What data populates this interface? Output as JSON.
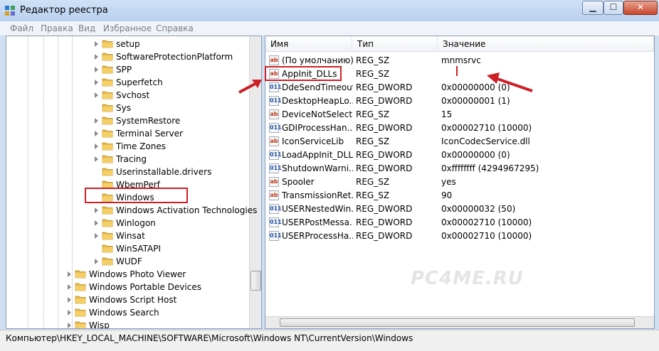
{
  "window": {
    "title": "Редактор реестра"
  },
  "menu": [
    "Файл",
    "Правка",
    "Вид",
    "Избранное",
    "Справка"
  ],
  "tree": {
    "items": [
      {
        "label": "setup",
        "expandable": true
      },
      {
        "label": "SoftwareProtectionPlatform",
        "expandable": true
      },
      {
        "label": "SPP",
        "expandable": true
      },
      {
        "label": "Superfetch",
        "expandable": true
      },
      {
        "label": "Svchost",
        "expandable": true
      },
      {
        "label": "Sys",
        "expandable": false
      },
      {
        "label": "SystemRestore",
        "expandable": true
      },
      {
        "label": "Terminal Server",
        "expandable": true
      },
      {
        "label": "Time Zones",
        "expandable": true
      },
      {
        "label": "Tracing",
        "expandable": true
      },
      {
        "label": "Userinstallable.drivers",
        "expandable": false
      },
      {
        "label": "WbemPerf",
        "expandable": false
      },
      {
        "label": "Windows",
        "expandable": false,
        "highlighted": true
      },
      {
        "label": "Windows Activation Technologies",
        "expandable": true
      },
      {
        "label": "Winlogon",
        "expandable": true
      },
      {
        "label": "Winsat",
        "expandable": true
      },
      {
        "label": "WinSATAPI",
        "expandable": false
      },
      {
        "label": "WUDF",
        "expandable": true
      },
      {
        "label": "Windows Photo Viewer",
        "expandable": true,
        "level": 1
      },
      {
        "label": "Windows Portable Devices",
        "expandable": true,
        "level": 1
      },
      {
        "label": "Windows Script Host",
        "expandable": true,
        "level": 1
      },
      {
        "label": "Windows Search",
        "expandable": true,
        "level": 1
      },
      {
        "label": "Wisp",
        "expandable": true,
        "level": 1
      }
    ]
  },
  "list": {
    "headers": {
      "name": "Имя",
      "type": "Тип",
      "value": "Значение"
    },
    "rows": [
      {
        "name": "(По умолчанию)",
        "type": "REG_SZ",
        "value": "mnmsrvc",
        "icon": "string-value-icon"
      },
      {
        "name": "AppInit_DLLs",
        "type": "REG_SZ",
        "value": "",
        "icon": "string-value-icon",
        "highlighted": true
      },
      {
        "name": "DdeSendTimeout",
        "type": "REG_DWORD",
        "value": "0x00000000 (0)",
        "icon": "dword-value-icon"
      },
      {
        "name": "DesktopHeapLo...",
        "type": "REG_DWORD",
        "value": "0x00000001 (1)",
        "icon": "dword-value-icon"
      },
      {
        "name": "DeviceNotSelect...",
        "type": "REG_SZ",
        "value": "15",
        "icon": "string-value-icon"
      },
      {
        "name": "GDIProcessHan...",
        "type": "REG_DWORD",
        "value": "0x00002710 (10000)",
        "icon": "dword-value-icon"
      },
      {
        "name": "IconServiceLib",
        "type": "REG_SZ",
        "value": "IconCodecService.dll",
        "icon": "string-value-icon"
      },
      {
        "name": "LoadAppInit_DLLs",
        "type": "REG_DWORD",
        "value": "0x00000000 (0)",
        "icon": "dword-value-icon"
      },
      {
        "name": "ShutdownWarni...",
        "type": "REG_DWORD",
        "value": "0xffffffff (4294967295)",
        "icon": "dword-value-icon"
      },
      {
        "name": "Spooler",
        "type": "REG_SZ",
        "value": "yes",
        "icon": "string-value-icon"
      },
      {
        "name": "TransmissionRet...",
        "type": "REG_SZ",
        "value": "90",
        "icon": "string-value-icon"
      },
      {
        "name": "USERNestedWin...",
        "type": "REG_DWORD",
        "value": "0x00000032 (50)",
        "icon": "dword-value-icon"
      },
      {
        "name": "USERPostMessa...",
        "type": "REG_DWORD",
        "value": "0x00002710 (10000)",
        "icon": "dword-value-icon"
      },
      {
        "name": "USERProcessHa...",
        "type": "REG_DWORD",
        "value": "0x00002710 (10000)",
        "icon": "dword-value-icon"
      }
    ],
    "icon_text": {
      "sz": "ab",
      "dw": "011"
    }
  },
  "watermark": "PC4ME.RU",
  "status": {
    "path": "Компьютер\\HKEY_LOCAL_MACHINE\\SOFTWARE\\Microsoft\\Windows NT\\CurrentVersion\\Windows"
  },
  "colors": {
    "highlight": "#cc2026",
    "window_frame": "#cfe0f3"
  }
}
